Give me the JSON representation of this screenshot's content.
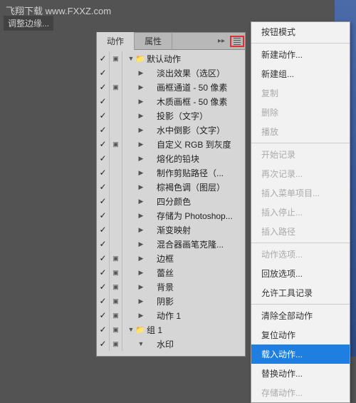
{
  "watermark_top": "飞翔下载 www.FXXZ.com",
  "toolbar_label": "调整边缘...",
  "panel": {
    "tabs": {
      "actions": "动作",
      "properties": "属性",
      "arrows": "▸▸"
    },
    "tree": [
      {
        "check": "✓",
        "box": "▣",
        "indent": 0,
        "arrow": "▼",
        "icon": "📁",
        "label": "默认动作"
      },
      {
        "check": "✓",
        "box": "",
        "indent": 1,
        "arrow": "▶",
        "icon": "",
        "label": "淡出效果（选区）"
      },
      {
        "check": "✓",
        "box": "▣",
        "indent": 1,
        "arrow": "▶",
        "icon": "",
        "label": "画框通道 - 50 像素"
      },
      {
        "check": "✓",
        "box": "",
        "indent": 1,
        "arrow": "▶",
        "icon": "",
        "label": "木质画框 - 50 像素"
      },
      {
        "check": "✓",
        "box": "",
        "indent": 1,
        "arrow": "▶",
        "icon": "",
        "label": "投影（文字）"
      },
      {
        "check": "✓",
        "box": "",
        "indent": 1,
        "arrow": "▶",
        "icon": "",
        "label": "水中倒影（文字）"
      },
      {
        "check": "✓",
        "box": "▣",
        "indent": 1,
        "arrow": "▶",
        "icon": "",
        "label": "自定义 RGB 到灰度"
      },
      {
        "check": "✓",
        "box": "",
        "indent": 1,
        "arrow": "▶",
        "icon": "",
        "label": "熔化的铅块"
      },
      {
        "check": "✓",
        "box": "",
        "indent": 1,
        "arrow": "▶",
        "icon": "",
        "label": "制作剪贴路径（..."
      },
      {
        "check": "✓",
        "box": "",
        "indent": 1,
        "arrow": "▶",
        "icon": "",
        "label": "棕褐色调（图层）"
      },
      {
        "check": "✓",
        "box": "",
        "indent": 1,
        "arrow": "▶",
        "icon": "",
        "label": "四分颜色"
      },
      {
        "check": "✓",
        "box": "",
        "indent": 1,
        "arrow": "▶",
        "icon": "",
        "label": "存储为 Photoshop..."
      },
      {
        "check": "✓",
        "box": "",
        "indent": 1,
        "arrow": "▶",
        "icon": "",
        "label": "渐变映射"
      },
      {
        "check": "✓",
        "box": "",
        "indent": 1,
        "arrow": "▶",
        "icon": "",
        "label": "混合器画笔克隆..."
      },
      {
        "check": "✓",
        "box": "▣",
        "indent": 1,
        "arrow": "▶",
        "icon": "",
        "label": "边框"
      },
      {
        "check": "✓",
        "box": "▣",
        "indent": 1,
        "arrow": "▶",
        "icon": "",
        "label": "蕾丝"
      },
      {
        "check": "✓",
        "box": "▣",
        "indent": 1,
        "arrow": "▶",
        "icon": "",
        "label": "背景"
      },
      {
        "check": "✓",
        "box": "▣",
        "indent": 1,
        "arrow": "▶",
        "icon": "",
        "label": "阴影"
      },
      {
        "check": "✓",
        "box": "▣",
        "indent": 1,
        "arrow": "▶",
        "icon": "",
        "label": "动作 1"
      },
      {
        "check": "✓",
        "box": "▣",
        "indent": 0,
        "arrow": "▼",
        "icon": "📁",
        "label": "组 1"
      },
      {
        "check": "✓",
        "box": "▣",
        "indent": 1,
        "arrow": "▼",
        "icon": "",
        "label": "水印"
      }
    ]
  },
  "menu": {
    "button_mode": "按钮模式",
    "new_action": "新建动作...",
    "new_group": "新建组...",
    "duplicate": "复制",
    "delete": "删除",
    "play": "播放",
    "start_record": "开始记录",
    "record_again": "再次记录...",
    "insert_menu": "插入菜单项目...",
    "insert_stop": "插入停止...",
    "insert_path": "插入路径",
    "action_options": "动作选项...",
    "playback_options": "回放选项...",
    "allow_tool_record": "允许工具记录",
    "clear_all": "清除全部动作",
    "reset_actions": "复位动作",
    "load_actions": "载入动作...",
    "replace_actions": "替换动作...",
    "save_actions": "存储动作..."
  },
  "logo": {
    "brand": "飞翔下载",
    "url": "www.fxxz.com"
  }
}
